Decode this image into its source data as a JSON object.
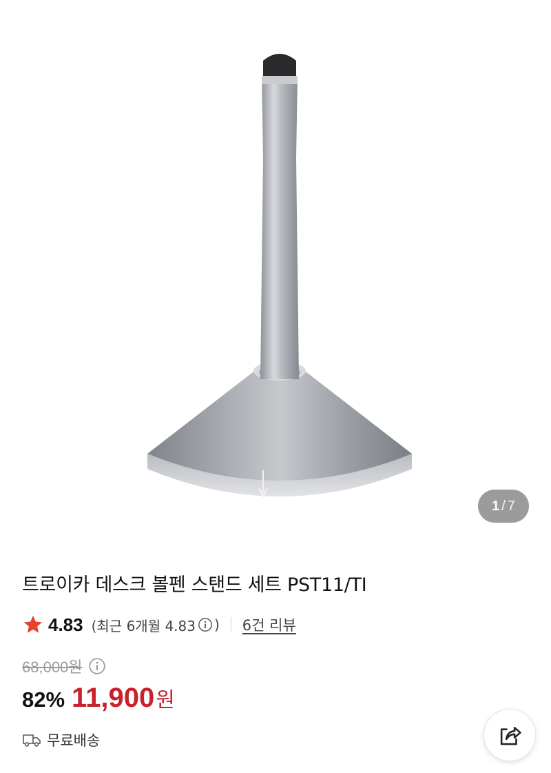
{
  "gallery": {
    "image_alt": "트로이카 데스크 볼펜 스탠드 세트",
    "current_page": "1",
    "separator": "/",
    "total_pages": "7"
  },
  "product": {
    "title": "트로이카 데스크 볼펜 스탠드 세트 PST11/TI"
  },
  "rating": {
    "icon": "star-icon",
    "score": "4.83",
    "recent_prefix": "(최근 6개월 4.83",
    "recent_suffix": ")",
    "review_link": "6건 리뷰"
  },
  "pricing": {
    "original_price": "68,000원",
    "discount": "82%",
    "sale_price": "11,900",
    "currency": "원"
  },
  "shipping": {
    "icon": "truck-icon",
    "label": "무료배송"
  },
  "actions": {
    "share_icon": "share-icon"
  },
  "colors": {
    "sale_red": "#c8222b",
    "star_red": "#e8412c",
    "indicator_bg": "#9b9b9b"
  }
}
